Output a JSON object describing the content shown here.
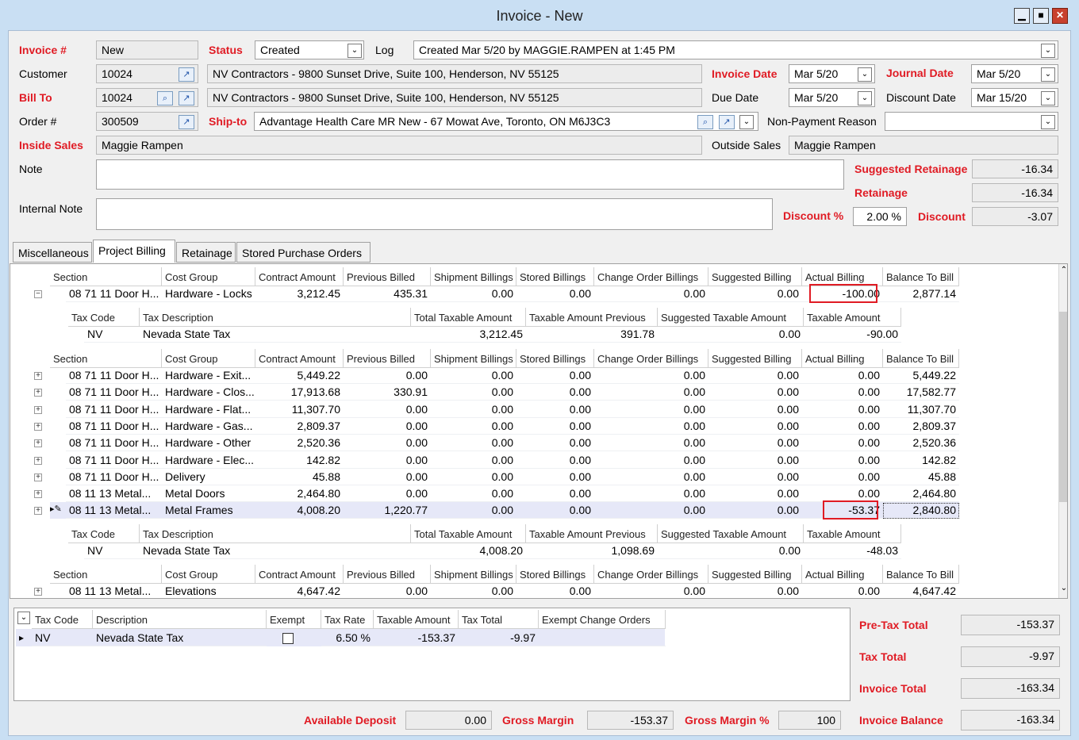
{
  "window": {
    "title": "Invoice - New"
  },
  "header": {
    "invoice_label": "Invoice #",
    "invoice_value": "New",
    "status_label": "Status",
    "status_value": "Created",
    "log_label": "Log",
    "log_value": "Created Mar 5/20 by MAGGIE.RAMPEN at 1:45 PM",
    "customer_label": "Customer",
    "customer_value": "10024",
    "customer_address": "NV Contractors - 9800 Sunset Drive, Suite 100, Henderson, NV  55125",
    "invoice_date_label": "Invoice Date",
    "invoice_date_value": "Mar 5/20",
    "journal_date_label": "Journal Date",
    "journal_date_value": "Mar 5/20",
    "bill_to_label": "Bill To",
    "bill_to_value": "10024",
    "bill_to_address": "NV Contractors - 9800 Sunset Drive, Suite 100, Henderson, NV  55125",
    "due_date_label": "Due Date",
    "due_date_value": "Mar 5/20",
    "discount_date_label": "Discount Date",
    "discount_date_value": "Mar 15/20",
    "order_label": "Order #",
    "order_value": "300509",
    "ship_to_label": "Ship-to",
    "ship_to_value": "Advantage Health Care MR New - 67 Mowat Ave, Toronto, ON  M6J3C3",
    "non_payment_label": "Non-Payment Reason",
    "non_payment_value": "",
    "inside_sales_label": "Inside Sales",
    "inside_sales_value": "Maggie Rampen",
    "outside_sales_label": "Outside Sales",
    "outside_sales_value": "Maggie Rampen",
    "note_label": "Note",
    "internal_note_label": "Internal Note",
    "suggested_retainage_label": "Suggested Retainage",
    "suggested_retainage_value": "-16.34",
    "retainage_label": "Retainage",
    "retainage_value": "-16.34",
    "discount_pct_label": "Discount %",
    "discount_pct_value": "2.00 %",
    "discount_label": "Discount",
    "discount_value": "-3.07"
  },
  "tabs": [
    "Miscellaneous",
    "Project Billing",
    "Retainage",
    "Stored Purchase Orders"
  ],
  "grid": {
    "section_headers": [
      "Section",
      "Cost Group",
      "Contract Amount",
      "Previous Billed",
      "Shipment Billings",
      "Stored Billings",
      "Change Order Billings",
      "Suggested Billing",
      "Actual Billing",
      "Balance To Bill"
    ],
    "tax_headers": [
      "Tax Code",
      "Tax Description",
      "Total Taxable Amount",
      "Taxable Amount Previous",
      "Suggested Taxable Amount",
      "Taxable Amount"
    ],
    "group1_rows": [
      [
        "08 71 11 Door H...",
        "Hardware - Locks",
        "3,212.45",
        "435.31",
        "0.00",
        "0.00",
        "0.00",
        "0.00",
        "-100.00",
        "2,877.14"
      ]
    ],
    "group1_tax": [
      "NV",
      "Nevada State Tax",
      "3,212.45",
      "391.78",
      "0.00",
      "-90.00"
    ],
    "group2_rows": [
      [
        "08 71 11 Door H...",
        "Hardware - Exit...",
        "5,449.22",
        "0.00",
        "0.00",
        "0.00",
        "0.00",
        "0.00",
        "0.00",
        "5,449.22"
      ],
      [
        "08 71 11 Door H...",
        "Hardware - Clos...",
        "17,913.68",
        "330.91",
        "0.00",
        "0.00",
        "0.00",
        "0.00",
        "0.00",
        "17,582.77"
      ],
      [
        "08 71 11 Door H...",
        "Hardware - Flat...",
        "11,307.70",
        "0.00",
        "0.00",
        "0.00",
        "0.00",
        "0.00",
        "0.00",
        "11,307.70"
      ],
      [
        "08 71 11 Door H...",
        "Hardware - Gas...",
        "2,809.37",
        "0.00",
        "0.00",
        "0.00",
        "0.00",
        "0.00",
        "0.00",
        "2,809.37"
      ],
      [
        "08 71 11 Door H...",
        "Hardware - Other",
        "2,520.36",
        "0.00",
        "0.00",
        "0.00",
        "0.00",
        "0.00",
        "0.00",
        "2,520.36"
      ],
      [
        "08 71 11 Door H...",
        "Hardware - Elec...",
        "142.82",
        "0.00",
        "0.00",
        "0.00",
        "0.00",
        "0.00",
        "0.00",
        "142.82"
      ],
      [
        "08 71 11 Door H...",
        "Delivery",
        "45.88",
        "0.00",
        "0.00",
        "0.00",
        "0.00",
        "0.00",
        "0.00",
        "45.88"
      ],
      [
        "08 11 13 Metal...",
        "Metal Doors",
        "2,464.80",
        "0.00",
        "0.00",
        "0.00",
        "0.00",
        "0.00",
        "0.00",
        "2,464.80"
      ],
      [
        "08 11 13 Metal...",
        "Metal Frames",
        "4,008.20",
        "1,220.77",
        "0.00",
        "0.00",
        "0.00",
        "0.00",
        "-53.37",
        "2,840.80"
      ]
    ],
    "group2_tax": [
      "NV",
      "Nevada State Tax",
      "4,008.20",
      "1,098.69",
      "0.00",
      "-48.03"
    ],
    "group3_rows": [
      [
        "08 11 13 Metal...",
        "Elevations",
        "4,647.42",
        "0.00",
        "0.00",
        "0.00",
        "0.00",
        "0.00",
        "0.00",
        "4,647.42"
      ]
    ]
  },
  "tax_grid": {
    "headers": [
      "Tax Code",
      "Description",
      "Exempt",
      "Tax Rate",
      "Taxable Amount",
      "Tax Total",
      "Exempt Change Orders"
    ],
    "row": [
      "NV",
      "Nevada State Tax",
      "",
      "6.50 %",
      "-153.37",
      "-9.97",
      ""
    ]
  },
  "totals": {
    "pre_tax_label": "Pre-Tax Total",
    "pre_tax_value": "-153.37",
    "tax_label": "Tax Total",
    "tax_value": "-9.97",
    "invoice_total_label": "Invoice Total",
    "invoice_total_value": "-163.34",
    "invoice_balance_label": "Invoice Balance",
    "invoice_balance_value": "-163.34",
    "available_deposit_label": "Available Deposit",
    "available_deposit_value": "0.00",
    "gross_margin_label": "Gross Margin",
    "gross_margin_value": "-153.37",
    "gross_margin_pct_label": "Gross Margin %",
    "gross_margin_pct_value": "100"
  },
  "colors": {
    "accent_red": "#e01b24",
    "window_bg": "#c9dff3"
  }
}
